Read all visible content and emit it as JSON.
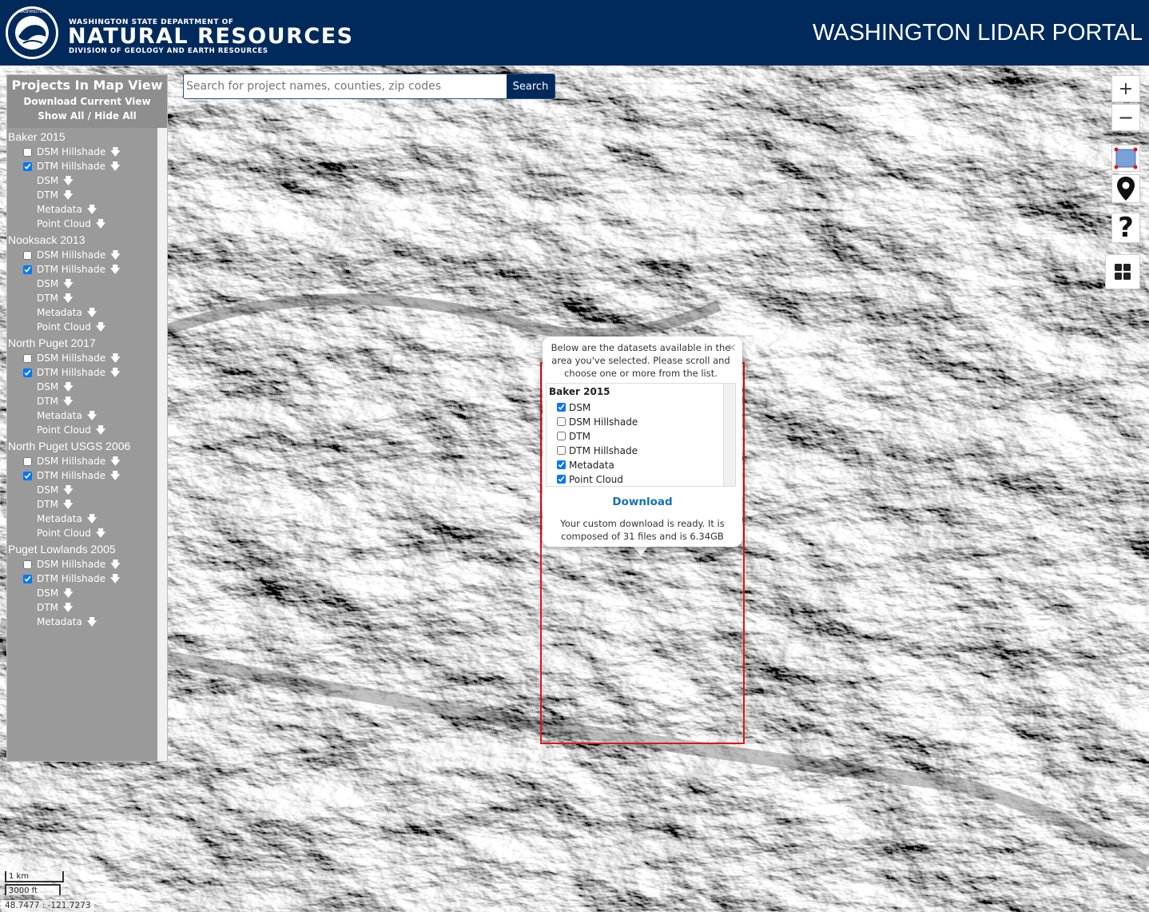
{
  "header": {
    "agency_top": "WASHINGTON STATE DEPARTMENT OF",
    "agency_main": "NATURAL RESOURCES",
    "agency_sub": "DIVISION OF GEOLOGY AND EARTH RESOURCES",
    "portal_title": "WASHINGTON LIDAR PORTAL",
    "background_color": "#002a5c"
  },
  "sidebar": {
    "title": "Projects In Map View",
    "download_current": "Download Current View",
    "show_hide": "Show All / Hide All",
    "projects": [
      {
        "name": "Baker 2015",
        "datasets": [
          {
            "label": "DSM Hillshade",
            "checkbox": true,
            "checked": false
          },
          {
            "label": "DTM Hillshade",
            "checkbox": true,
            "checked": true
          },
          {
            "label": "DSM",
            "checkbox": false
          },
          {
            "label": "DTM",
            "checkbox": false
          },
          {
            "label": "Metadata",
            "checkbox": false
          },
          {
            "label": "Point Cloud",
            "checkbox": false
          }
        ]
      },
      {
        "name": "Nooksack 2013",
        "datasets": [
          {
            "label": "DSM Hillshade",
            "checkbox": true,
            "checked": false
          },
          {
            "label": "DTM Hillshade",
            "checkbox": true,
            "checked": true
          },
          {
            "label": "DSM",
            "checkbox": false
          },
          {
            "label": "DTM",
            "checkbox": false
          },
          {
            "label": "Metadata",
            "checkbox": false
          },
          {
            "label": "Point Cloud",
            "checkbox": false
          }
        ]
      },
      {
        "name": "North Puget 2017",
        "datasets": [
          {
            "label": "DSM Hillshade",
            "checkbox": true,
            "checked": false
          },
          {
            "label": "DTM Hillshade",
            "checkbox": true,
            "checked": true
          },
          {
            "label": "DSM",
            "checkbox": false
          },
          {
            "label": "DTM",
            "checkbox": false
          },
          {
            "label": "Metadata",
            "checkbox": false
          },
          {
            "label": "Point Cloud",
            "checkbox": false
          }
        ]
      },
      {
        "name": "North Puget USGS 2006",
        "datasets": [
          {
            "label": "DSM Hillshade",
            "checkbox": true,
            "checked": false
          },
          {
            "label": "DTM Hillshade",
            "checkbox": true,
            "checked": true
          },
          {
            "label": "DSM",
            "checkbox": false
          },
          {
            "label": "DTM",
            "checkbox": false
          },
          {
            "label": "Metadata",
            "checkbox": false
          },
          {
            "label": "Point Cloud",
            "checkbox": false
          }
        ]
      },
      {
        "name": "Puget Lowlands 2005",
        "datasets": [
          {
            "label": "DSM Hillshade",
            "checkbox": true,
            "checked": false
          },
          {
            "label": "DTM Hillshade",
            "checkbox": true,
            "checked": true
          },
          {
            "label": "DSM",
            "checkbox": false
          },
          {
            "label": "DTM",
            "checkbox": false
          },
          {
            "label": "Metadata",
            "checkbox": false
          }
        ]
      }
    ],
    "download_icon": "arrow-down-icon"
  },
  "search": {
    "placeholder": "Search for project names, counties, zip codes",
    "button_label": "Search"
  },
  "map_controls": {
    "zoom_in": "+",
    "zoom_out": "−",
    "help": "?",
    "icons": [
      "zoom-in-icon",
      "zoom-out-icon",
      "draw-rectangle-icon",
      "map-marker-icon",
      "help-icon",
      "layers-grid-icon"
    ]
  },
  "popup": {
    "intro": "Below are the datasets available in the area you've selected. Please scroll and choose one or more from the list.",
    "close": "×",
    "project": "Baker 2015",
    "options": [
      {
        "label": "DSM",
        "checked": true
      },
      {
        "label": "DSM Hillshade",
        "checked": false
      },
      {
        "label": "DTM",
        "checked": false
      },
      {
        "label": "DTM Hillshade",
        "checked": false
      },
      {
        "label": "Metadata",
        "checked": true
      },
      {
        "label": "Point Cloud",
        "checked": true
      }
    ],
    "download_label": "Download",
    "status": "Your custom download is ready. It is composed of 31 files and is 6.34GB",
    "selection_color": "#e01515",
    "link_color": "#1a6fb5"
  },
  "scale": {
    "km": "1 km",
    "ft": "3000 ft"
  },
  "coordinates": "48.7477 : -121.7273"
}
